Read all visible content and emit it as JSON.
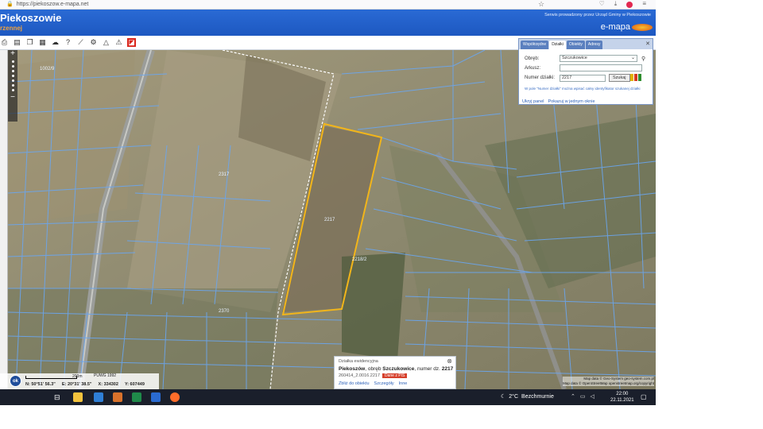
{
  "browser": {
    "url": "https://piekoszow.e-mapa.net"
  },
  "header": {
    "title": "Piekoszowie",
    "subtitle": "rzennej",
    "service_note": "Serwis prowadzony przez Urząd Gminy w Piekoszowie",
    "brand": "e-mapa"
  },
  "search_panel": {
    "tabs": [
      "Współrzędne",
      "Działki",
      "Obiekty",
      "Adresy"
    ],
    "active_tab": "Działki",
    "obreb_label": "Obręb:",
    "obreb_value": "Szczukowice",
    "arkusz_label": "Arkusz:",
    "arkusz_value": "",
    "numer_label": "Numer działki:",
    "numer_value": "2217",
    "search_button": "Szukaj",
    "hint": "W pole \"Numer działki\" można wpisać całny identyfikator szukanej działki",
    "hide_panel": "Ukryj panel",
    "show_one": "Pokazuj w jednym oknie",
    "colors": {
      "bar1": "#e2b300",
      "bar2": "#d63b1f",
      "bar3": "#2f8e2f"
    }
  },
  "map_labels": [
    {
      "text": "2317",
      "c": "parcel-1"
    },
    {
      "text": "2217",
      "c": "parcel-2"
    },
    {
      "text": "2218/2",
      "c": "parcel-3"
    },
    {
      "text": "1002/9",
      "c": "parcel-4"
    },
    {
      "text": "2370",
      "c": "parcel-5"
    }
  ],
  "statusbar": {
    "scale": "200m",
    "crs": "PUWG 1992",
    "ok": "ok",
    "n": "N: 50°51' 56.3\"",
    "e": "E: 20°31' 38.5\"",
    "x": "X: 334302",
    "y": "Y: 607449"
  },
  "info_popup": {
    "head": "Działka ewidencyjna",
    "gmina": "Piekoszów",
    "obreb_text": ", obręb ",
    "obreb": "Szczukowice",
    "numer_text": ", numer dz. ",
    "numer": "2217",
    "id": "260414_2.0016.2217",
    "badge": "Dane z PIS",
    "link1": "Zbliż do obiektu",
    "link2": "Szczegóły",
    "link3": "Inne"
  },
  "attribution": {
    "line1": "Map data © Geo-System geo-system.com.pl",
    "line2": "Map data © OpenStreetMap openstreetmap.org/copyright"
  },
  "taskbar": {
    "temp": "2°C",
    "weather": "Bezchmurnie",
    "time": "22:00",
    "date": "22.11.2021"
  }
}
